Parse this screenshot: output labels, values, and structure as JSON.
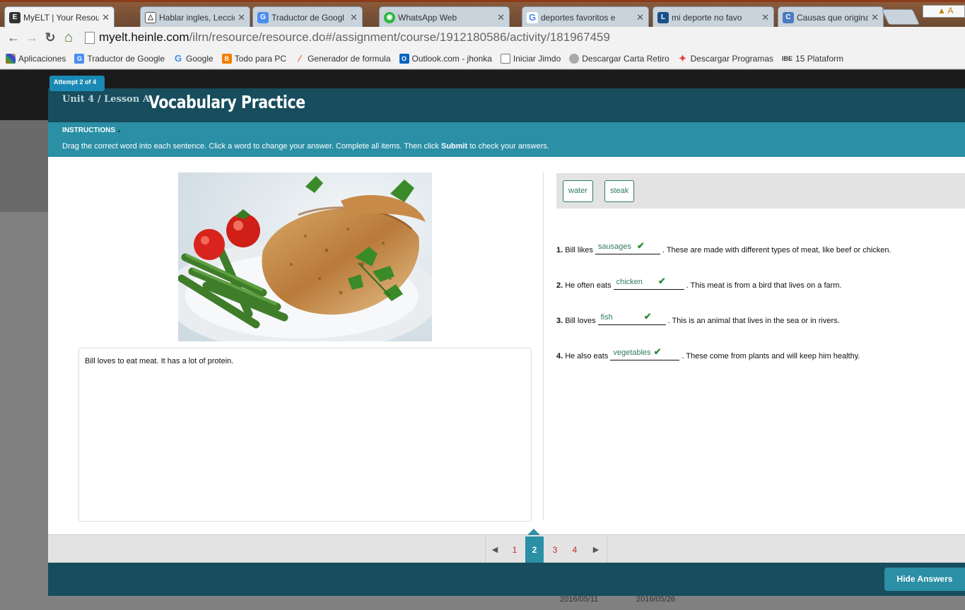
{
  "browser": {
    "tabs": [
      {
        "title": "MyELT | Your Resou",
        "icon": "myelt-icon",
        "active": true
      },
      {
        "title": "Hablar ingles, Leccio",
        "icon": "hablar-icon"
      },
      {
        "title": "Traductor de Googl",
        "icon": "google-translate-icon"
      },
      {
        "title": "WhatsApp Web",
        "icon": "whatsapp-icon"
      },
      {
        "title": "deportes favoritos e",
        "icon": "google-icon"
      },
      {
        "title": "mi deporte no favo",
        "icon": "lingq-icon"
      },
      {
        "title": "Causas que origina",
        "icon": "causas-icon"
      }
    ],
    "url_host": "myelt.heinle.com",
    "url_path": "/ilrn/resource/resource.do#/assignment/course/1912180586/activity/181967459",
    "bookmarks": [
      {
        "label": "Aplicaciones",
        "icon": "apps-icon"
      },
      {
        "label": "Traductor de Google",
        "icon": "google-translate-icon"
      },
      {
        "label": "Google",
        "icon": "google-icon"
      },
      {
        "label": "Todo para PC",
        "icon": "blogger-icon"
      },
      {
        "label": "Generador de formula",
        "icon": "formula-icon"
      },
      {
        "label": "Outlook.com - jhonka",
        "icon": "outlook-icon"
      },
      {
        "label": "Iniciar Jimdo",
        "icon": "page-icon"
      },
      {
        "label": "Descargar Carta Retiro",
        "icon": "carta-icon"
      },
      {
        "label": "Descargar Programas",
        "icon": "programas-icon"
      },
      {
        "label": "15 Plataform",
        "icon": "ibe-icon",
        "prefix": "IBE"
      }
    ]
  },
  "activity": {
    "attempt": "Attempt 2 of 4",
    "unit": "Unit 4 / Lesson A",
    "title": "Vocabulary Practice",
    "instructions_heading": "INSTRUCTIONS",
    "instructions_pre": "Drag the correct word into each sentence. Click a word to change your answer. Complete all items. Then click ",
    "instructions_bold": "Submit",
    "instructions_post": " to check your answers.",
    "passage": "Bill loves to eat meat. It has a lot of protein.",
    "word_bank": [
      "water",
      "steak"
    ],
    "questions": [
      {
        "num": "1.",
        "before": "Bill likes",
        "answer": "sausages",
        "after": ". These are made with different types of meat, like beef or chicken."
      },
      {
        "num": "2.",
        "before": "He often eats",
        "answer": "chicken",
        "after": ". This meat is from a bird that lives on a farm."
      },
      {
        "num": "3.",
        "before": "Bill loves",
        "answer": "fish",
        "after": ". This is an animal that lives in the sea or in rivers."
      },
      {
        "num": "4.",
        "before": "He also eats",
        "answer": "vegetables",
        "after": ". These come from plants and will keep him healthy."
      }
    ],
    "pages": [
      "1",
      "2",
      "3",
      "4"
    ],
    "current_page": "2",
    "hide_answers_label": "Hide Answers"
  },
  "background_page": {
    "dates": [
      "2016/05/11",
      "2016/05/26"
    ]
  },
  "colors": {
    "header": "#174d5c",
    "instructions": "#2b8fa6",
    "answer": "#2e7d5b",
    "check": "#2e8b3a"
  }
}
